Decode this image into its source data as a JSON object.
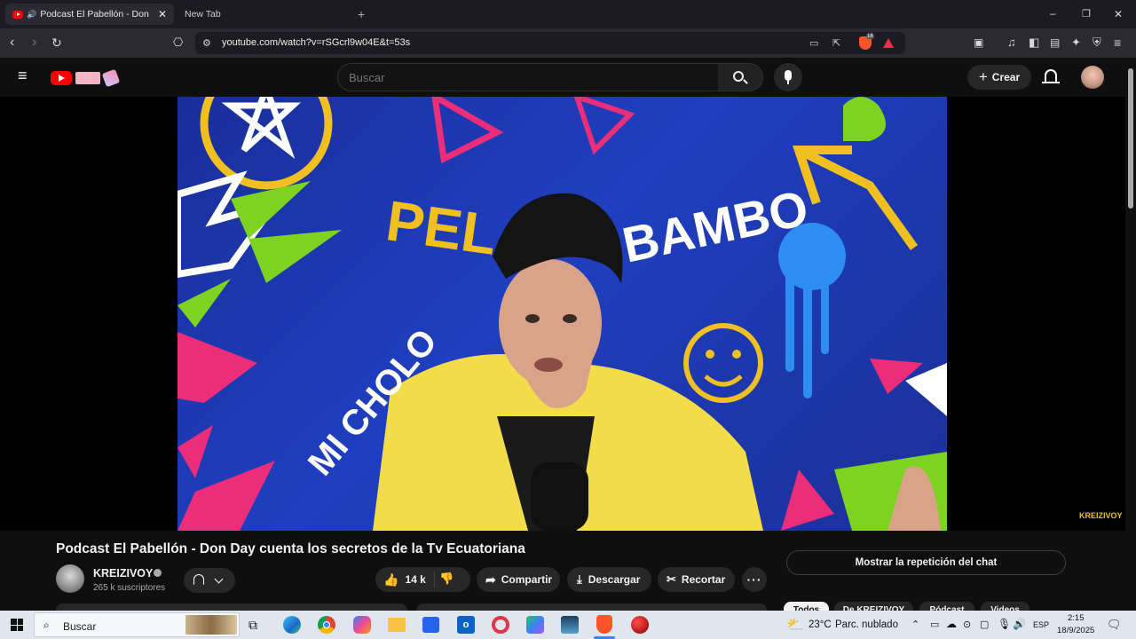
{
  "browser": {
    "tabs": [
      {
        "title": "Podcast El Pabellón - Don Da",
        "active": true
      },
      {
        "title": "New Tab",
        "active": false
      }
    ],
    "url": "youtube.com/watch?v=rSGcrl9w04E&t=53s",
    "brave_badge": "18"
  },
  "header": {
    "search_placeholder": "Buscar",
    "create_label": "Crear"
  },
  "video": {
    "title": "Podcast El Pabellón - Don Day cuenta los secretos de la Tv Ecuatoriana",
    "watermark": "KREIZIVOY",
    "wall_text_1": "PEL",
    "wall_text_2": "BAMBO",
    "wall_text_3": "MI CHOLO"
  },
  "channel": {
    "name": "KREIZIVOY",
    "subscribers": "265 k suscriptores"
  },
  "actions": {
    "likes": "14 k",
    "share": "Compartir",
    "download": "Descargar",
    "clip": "Recortar"
  },
  "chat": {
    "replay_label": "Mostrar la repetición del chat"
  },
  "filter_chips": [
    "Todos",
    "De KREIZIVOY",
    "Pódcast",
    "Videos"
  ],
  "taskbar": {
    "search_placeholder": "Buscar",
    "temperature": "23°C",
    "weather": "Parc. nublado",
    "language": "ESP",
    "time": "2:15",
    "date": "18/9/2025"
  },
  "colors": {
    "youtube_red": "#ff0000",
    "background": "#0f0f0f",
    "pill": "#272727",
    "shirt_yellow": "#f2dc4a",
    "wall_blue": "#1f3fc0"
  }
}
